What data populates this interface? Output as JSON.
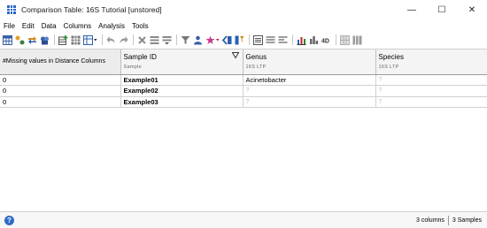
{
  "window": {
    "title": "Comparison Table: 16S Tutorial [unstored]",
    "minimize_glyph": "—",
    "maximize_glyph": "☐",
    "close_glyph": "✕"
  },
  "menu": [
    "File",
    "Edit",
    "Data",
    "Columns",
    "Analysis",
    "Tools"
  ],
  "table": {
    "first_column_header": "#Missing values in Distance Columns",
    "columns": [
      {
        "title": "Sample ID",
        "subtitle": "Sample"
      },
      {
        "title": "Genus",
        "subtitle": "16S LTP"
      },
      {
        "title": "Species",
        "subtitle": "16S LTP"
      }
    ],
    "rows": [
      {
        "missing": "0",
        "sample": "Example01",
        "genus": "Acinetobacter",
        "species": "?"
      },
      {
        "missing": "0",
        "sample": "Example02",
        "genus": "?",
        "species": "?"
      },
      {
        "missing": "0",
        "sample": "Example03",
        "genus": "?",
        "species": "?"
      }
    ]
  },
  "status": {
    "help_glyph": "?",
    "columns_count": "3 columns",
    "samples_count": "3 Samples"
  },
  "toolbar_icons": [
    "table-icon",
    "merge-icon",
    "arrows-icon",
    "lock-group-icon",
    "grid-add-icon",
    "grid-icon",
    "grid-dropdown-icon",
    "undo-icon",
    "redo-icon",
    "delete-icon",
    "rows-icon",
    "filter-rows-icon",
    "funnel-icon",
    "person-icon",
    "star-color-icon",
    "columns-icon",
    "column-filter-icon",
    "list-icon",
    "list-lines-icon",
    "list-alt-icon",
    "bar-chart-icon",
    "histogram-icon",
    "three-d-icon",
    "grid-disabled-icon",
    "block-icon"
  ],
  "colors": {
    "accent": "#2b64c6"
  }
}
